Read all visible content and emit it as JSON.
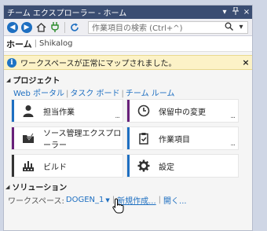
{
  "window": {
    "title": "チーム エクスプローラー - ホーム",
    "pin_glyph": "▾",
    "pin2_glyph": "ᵖ",
    "close_glyph": "×"
  },
  "toolbar": {
    "search_placeholder": "作業項目の検索 (Ctrl+^)",
    "search_dropdown": "▾"
  },
  "header": {
    "title": "ホーム",
    "separator": "|",
    "project": "Shikalog"
  },
  "infobar": {
    "message": "ワークスペースが正常にマップされました。",
    "close": "×",
    "icon_glyph": "i"
  },
  "project_section": {
    "title": "プロジェクト",
    "links": [
      "Web ポータル",
      "タスク ボード",
      "チーム ルーム"
    ],
    "separator": "|"
  },
  "tiles": [
    {
      "label": "担当作業",
      "icon": "person-icon",
      "stripe": "#1e6fc1",
      "dots": "..."
    },
    {
      "label": "保留中の変更",
      "icon": "clock-icon",
      "stripe": "#68217a",
      "dots": "..."
    },
    {
      "label": "ソース管理エクスプローラー",
      "icon": "folder-check-icon",
      "stripe": "#68217a",
      "dots": ""
    },
    {
      "label": "作業項目",
      "icon": "clipboard-icon",
      "stripe": "#1e6fc1",
      "dots": "..."
    },
    {
      "label": "ビルド",
      "icon": "build-icon",
      "stripe": "#333333",
      "dots": ""
    },
    {
      "label": "設定",
      "icon": "gear-icon",
      "stripe": "#1e6fc1",
      "dots": ""
    }
  ],
  "solution_section": {
    "title": "ソリューション",
    "workspace_label": "ワークスペース:",
    "workspace_value": "DOGEN_1",
    "new_link": "新規作成...",
    "open_link": "開く...",
    "separator": "|"
  }
}
